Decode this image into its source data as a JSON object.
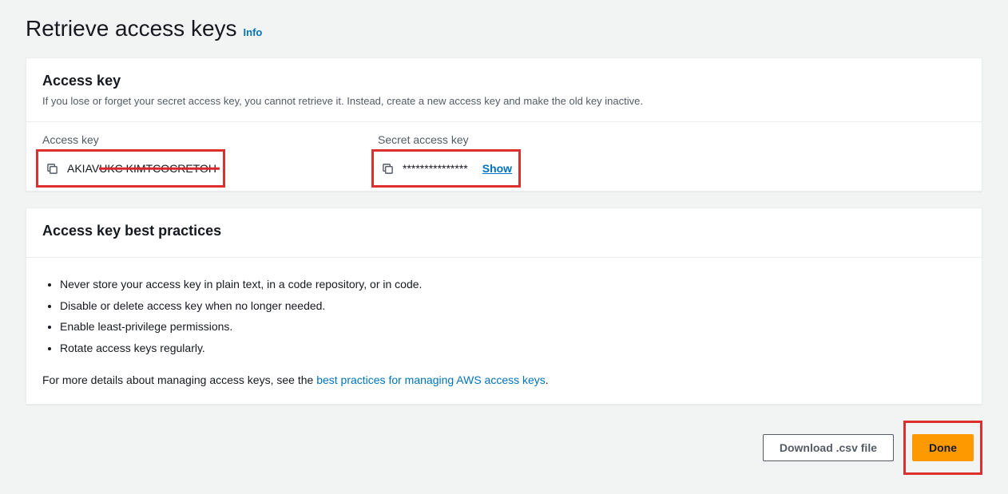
{
  "header": {
    "title": "Retrieve access keys",
    "info": "Info"
  },
  "access_key_panel": {
    "title": "Access key",
    "description": "If you lose or forget your secret access key, you cannot retrieve it. Instead, create a new access key and make the old key inactive.",
    "columns": {
      "access_key_label": "Access key",
      "access_key_value_prefix": "AKIAV",
      "access_key_value_redacted": "UKC KIMTCOCRETOH",
      "secret_label": "Secret access key",
      "secret_masked": "***************",
      "show_label": "Show"
    }
  },
  "best_practices": {
    "title": "Access key best practices",
    "items": [
      "Never store your access key in plain text, in a code repository, or in code.",
      "Disable or delete access key when no longer needed.",
      "Enable least-privilege permissions.",
      "Rotate access keys regularly."
    ],
    "more_prefix": "For more details about managing access keys, see the ",
    "more_link": "best practices for managing AWS access keys",
    "more_suffix": "."
  },
  "buttons": {
    "download": "Download .csv file",
    "done": "Done"
  }
}
